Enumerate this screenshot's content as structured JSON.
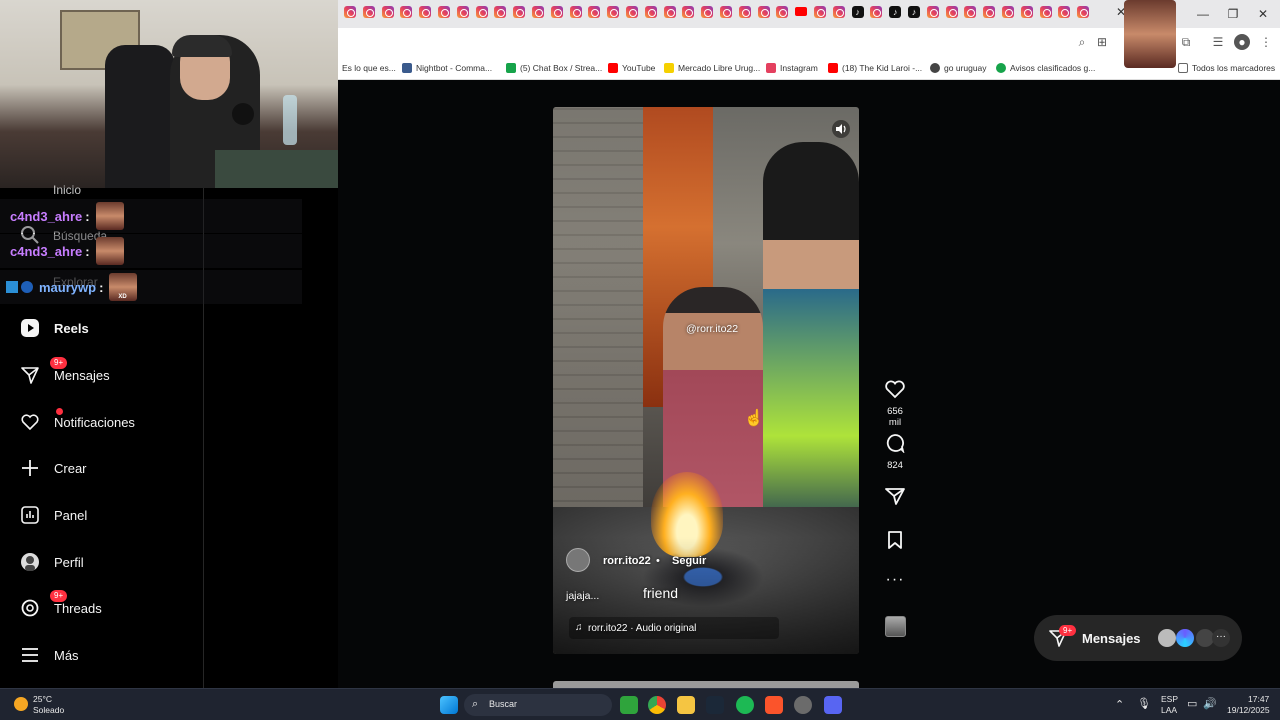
{
  "browser": {
    "bookmarks": [
      {
        "label": "Es lo que es...",
        "color": "#999999"
      },
      {
        "label": "Nightbot - Comma...",
        "color": "#3a5a8c"
      },
      {
        "label": "(5) Chat Box / Strea...",
        "color": "#16a34a"
      },
      {
        "label": "YouTube",
        "color": "#ff0000"
      },
      {
        "label": "Mercado Libre Urug...",
        "color": "#f5d000"
      },
      {
        "label": "Instagram",
        "color": "#e4405f"
      },
      {
        "label": "(18) The Kid Laroi -...",
        "color": "#ff0000"
      },
      {
        "label": "go uruguay",
        "color": "#444444"
      },
      {
        "label": "Avisos clasificados g...",
        "color": "#16a34a"
      },
      {
        "label": "Todos los marcadores",
        "color": "#666666"
      }
    ]
  },
  "chat": [
    {
      "user": "c4nd3_ahre",
      "sep": ":",
      "color": "#c77dff"
    },
    {
      "user": "c4nd3_ahre",
      "sep": ":",
      "color": "#c77dff"
    },
    {
      "user": "maurywp",
      "sep": ":",
      "color": "#7fb3ff"
    }
  ],
  "emote_label": "XD",
  "nav": {
    "ghost_inicio": "Inicio",
    "ghost_busqueda": "Búsqueda",
    "ghost_explorar": "Explorar",
    "items": [
      {
        "label": "Reels",
        "icon": "reels-icon"
      },
      {
        "label": "Mensajes",
        "icon": "messages-icon",
        "badge": "9+"
      },
      {
        "label": "Notificaciones",
        "icon": "heart-icon"
      },
      {
        "label": "Crear",
        "icon": "plus-icon"
      },
      {
        "label": "Panel",
        "icon": "panel-icon"
      },
      {
        "label": "Perfil",
        "icon": "profile-icon"
      },
      {
        "label": "Threads",
        "icon": "threads-icon",
        "badge": "9+"
      },
      {
        "label": "Más",
        "icon": "menu-icon"
      }
    ]
  },
  "reel": {
    "tag": "@rorr.ito22",
    "username": "rorr.ito22",
    "dot": "•",
    "follow": "Seguir",
    "caption": "jajaja...",
    "subtitle": "friend",
    "audio": "rorr.ito22 · Audio original",
    "likes": "656 mil",
    "comments": "824"
  },
  "messages_pill": {
    "label": "Mensajes",
    "badge": "9+"
  },
  "taskbar": {
    "weather_temp": "25°C",
    "weather_desc": "Soleado",
    "search": "Buscar",
    "lang1": "ESP",
    "lang2": "LAA",
    "time": "17:47",
    "date": "19/12/2025"
  }
}
